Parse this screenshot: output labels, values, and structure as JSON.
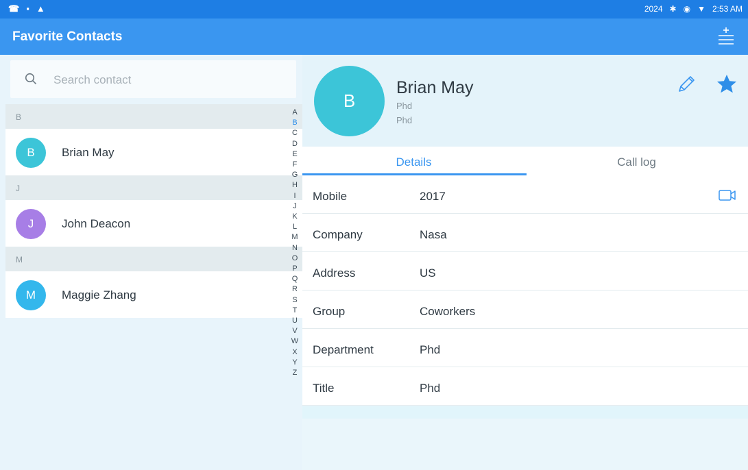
{
  "status_bar": {
    "date": "2024",
    "time": "2:53 AM"
  },
  "app_bar": {
    "title": "Favorite Contacts"
  },
  "search": {
    "placeholder": "Search contact"
  },
  "sections": [
    {
      "letter": "B",
      "contacts": [
        {
          "initial": "B",
          "name": "Brian May",
          "color": "#3cc5d8"
        }
      ]
    },
    {
      "letter": "J",
      "contacts": [
        {
          "initial": "J",
          "name": "John Deacon",
          "color": "#a77ee6"
        }
      ]
    },
    {
      "letter": "M",
      "contacts": [
        {
          "initial": "M",
          "name": "Maggie Zhang",
          "color": "#33b7ec"
        }
      ]
    }
  ],
  "alphabet": [
    "A",
    "B",
    "C",
    "D",
    "E",
    "F",
    "G",
    "H",
    "I",
    "J",
    "K",
    "L",
    "M",
    "N",
    "O",
    "P",
    "Q",
    "R",
    "S",
    "T",
    "U",
    "V",
    "W",
    "X",
    "Y",
    "Z"
  ],
  "alphabet_active": "B",
  "detail": {
    "initial": "B",
    "name": "Brian May",
    "sub1": "Phd",
    "sub2": "Phd",
    "tabs": [
      "Details",
      "Call log"
    ],
    "active_tab": "Details",
    "fields": [
      {
        "label": "Mobile",
        "value": "2017",
        "icon": "video-call-icon"
      },
      {
        "label": "Company",
        "value": "Nasa"
      },
      {
        "label": "Address",
        "value": "US"
      },
      {
        "label": "Group",
        "value": "Coworkers"
      },
      {
        "label": "Department",
        "value": "Phd"
      },
      {
        "label": "Title",
        "value": "Phd"
      }
    ]
  },
  "colors": {
    "status_bar": "#1e7ee4",
    "app_bar": "#3a96f0",
    "accent": "#3a96f0"
  }
}
